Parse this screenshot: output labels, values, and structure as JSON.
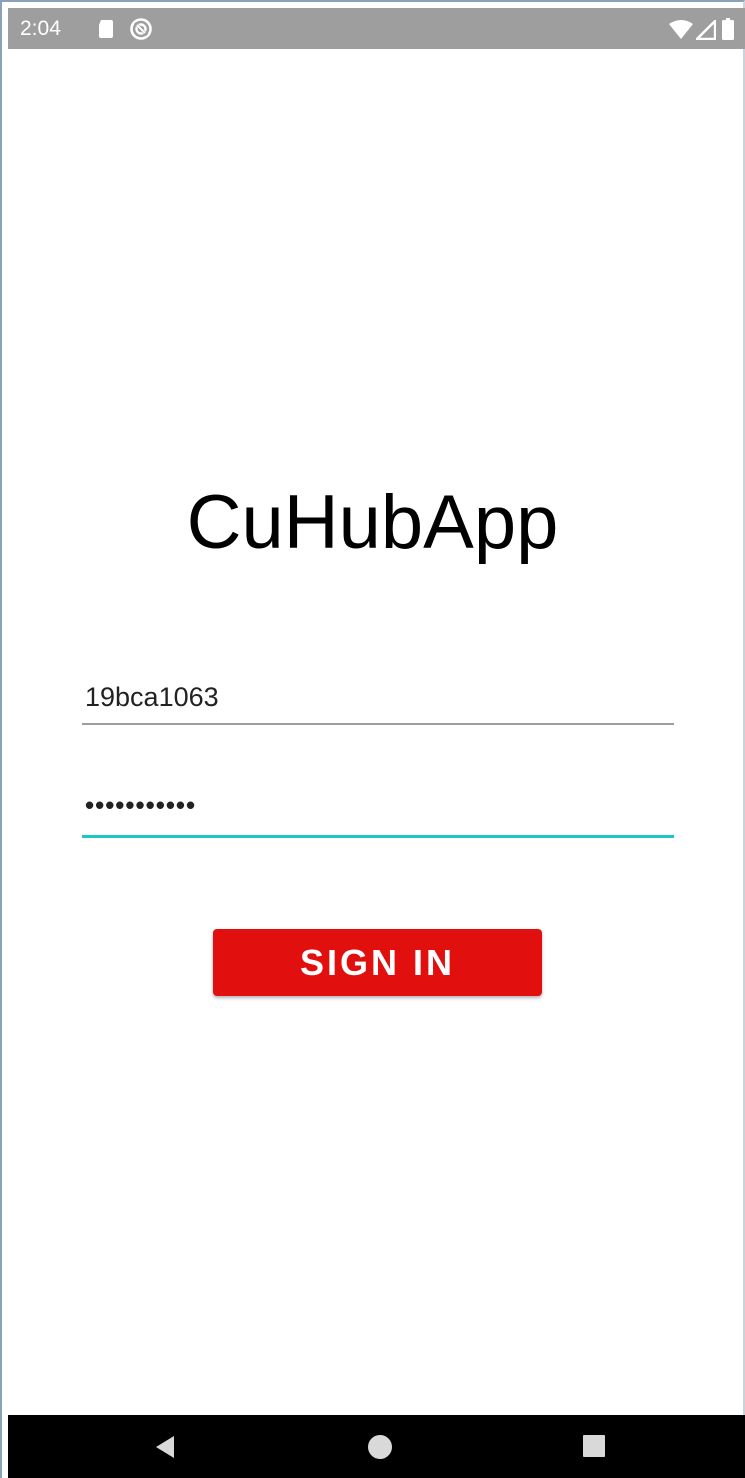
{
  "status_bar": {
    "time": "2:04",
    "icons": [
      "sd-card-icon",
      "sync-icon",
      "wifi-icon",
      "signal-icon",
      "battery-icon"
    ],
    "background": "#9e9e9e"
  },
  "app": {
    "title": "CuHubApp"
  },
  "login": {
    "username_value": "19bca1063",
    "password_value": "•••••••••••",
    "sign_in_label": "SIGN IN",
    "button_color": "#e20f0f",
    "focus_color": "#1ec7c7"
  },
  "nav_bar": {
    "icons": [
      "back-icon",
      "home-icon",
      "recents-icon"
    ]
  }
}
